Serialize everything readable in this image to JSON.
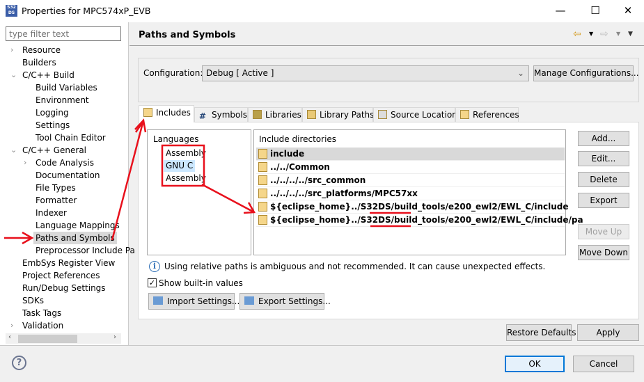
{
  "window": {
    "title": "Properties for MPC574xP_EVB",
    "app_icon": "S32DS",
    "controls": [
      "minimize",
      "maximize",
      "close"
    ]
  },
  "sidebar": {
    "filter_placeholder": "type filter text",
    "items": [
      {
        "label": "Resource",
        "level": 0,
        "expander": "collapsed"
      },
      {
        "label": "Builders",
        "level": 0
      },
      {
        "label": "C/C++ Build",
        "level": 0,
        "expander": "expanded"
      },
      {
        "label": "Build Variables",
        "level": 1
      },
      {
        "label": "Environment",
        "level": 1
      },
      {
        "label": "Logging",
        "level": 1
      },
      {
        "label": "Settings",
        "level": 1
      },
      {
        "label": "Tool Chain Editor",
        "level": 1
      },
      {
        "label": "C/C++ General",
        "level": 0,
        "expander": "expanded"
      },
      {
        "label": "Code Analysis",
        "level": 1,
        "expander": "collapsed"
      },
      {
        "label": "Documentation",
        "level": 1
      },
      {
        "label": "File Types",
        "level": 1
      },
      {
        "label": "Formatter",
        "level": 1
      },
      {
        "label": "Indexer",
        "level": 1
      },
      {
        "label": "Language Mappings",
        "level": 1
      },
      {
        "label": "Paths and Symbols",
        "level": 1,
        "selected": true
      },
      {
        "label": "Preprocessor Include Pa",
        "level": 1
      },
      {
        "label": "EmbSys Register View",
        "level": 0
      },
      {
        "label": "Project References",
        "level": 0
      },
      {
        "label": "Run/Debug Settings",
        "level": 0
      },
      {
        "label": "SDKs",
        "level": 0
      },
      {
        "label": "Task Tags",
        "level": 0
      },
      {
        "label": "Validation",
        "level": 0,
        "expander": "collapsed"
      }
    ]
  },
  "page": {
    "title": "Paths and Symbols",
    "configuration": {
      "label": "Configuration:",
      "value": "Debug  [ Active ]",
      "manage_label": "Manage Configurations..."
    },
    "tabs": [
      {
        "label": "Includes",
        "icon": "includes-icon",
        "active": true
      },
      {
        "label": "Symbols",
        "icon": "hash-icon"
      },
      {
        "label": "Libraries",
        "icon": "libraries-icon"
      },
      {
        "label": "Library Paths",
        "icon": "library-paths-icon"
      },
      {
        "label": "Source Location",
        "icon": "folder-icon"
      },
      {
        "label": "References",
        "icon": "references-icon"
      }
    ],
    "languages": {
      "header": "Languages",
      "items": [
        "Assembly",
        "GNU C",
        "Assembly"
      ],
      "selected": 1
    },
    "includes": {
      "header": "Include directories",
      "items": [
        {
          "path": "include",
          "bold": true,
          "selected": true
        },
        {
          "path": "../../Common",
          "bold": true
        },
        {
          "path": "../../../../src_common",
          "bold": true
        },
        {
          "path": "../../../../src_platforms/MPC57xx",
          "bold": true
        },
        {
          "path": "${eclipse_home}../S32DS/build_tools/e200_ewl2/EWL_C/include",
          "bold": true
        },
        {
          "path": "${eclipse_home}../S32DS/build_tools/e200_ewl2/EWL_C/include/pa",
          "bold": true
        }
      ]
    },
    "buttons": {
      "add": "Add...",
      "edit": "Edit...",
      "delete": "Delete",
      "export": "Export",
      "move_up": "Move Up",
      "move_down": "Move Down"
    },
    "info": "Using relative paths is ambiguous and not recommended. It can cause unexpected effects.",
    "show_builtin": {
      "label": "Show built-in values",
      "checked": true
    },
    "import_label": "Import Settings...",
    "export_label": "Export Settings...",
    "restore_label": "Restore Defaults",
    "apply_label": "Apply"
  },
  "footer": {
    "ok_label": "OK",
    "cancel_label": "Cancel"
  },
  "colors": {
    "annotation": "#e8101c",
    "selection": "#cce8ff"
  }
}
